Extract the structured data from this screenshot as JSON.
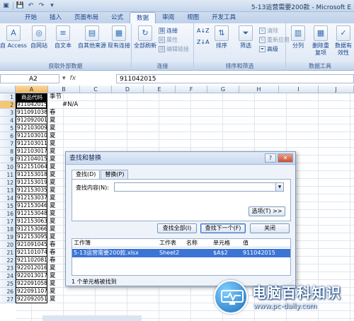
{
  "window": {
    "title": "5-13运营需要200款 - Microsoft E"
  },
  "ribbon_tabs": [
    "开始",
    "插入",
    "页面布局",
    "公式",
    "数据",
    "审阅",
    "视图",
    "开发工具"
  ],
  "active_tab_index": 4,
  "groups": {
    "external": {
      "label": "获取外部数据",
      "buttons": [
        "自 Access",
        "自网站",
        "自文本",
        "自其他来源",
        "现有连接"
      ]
    },
    "connections": {
      "label": "连接",
      "refresh": "全部刷新",
      "items": [
        "连接",
        "属性",
        "编辑链接"
      ]
    },
    "sortfilter": {
      "label": "排序和筛选",
      "sort": "排序",
      "filter": "筛选",
      "items": [
        "清除",
        "重新应用",
        "高级"
      ]
    },
    "tools": {
      "label": "数据工具",
      "buttons": [
        "分列",
        "删除重复项",
        "数据有效性"
      ]
    }
  },
  "formula_bar": {
    "name_box": "A2",
    "fx": "fx",
    "value": "911042015"
  },
  "columns": [
    "A",
    "B",
    "C",
    "D",
    "E",
    "F",
    "G",
    "H",
    "I",
    "J"
  ],
  "sheet": {
    "header_a": "商品代码",
    "header_b": "季节",
    "b2": "#N/A",
    "rows": [
      {
        "n": "1",
        "a": "商品代码",
        "b": "季节"
      },
      {
        "n": "2",
        "a": "911042015",
        "b": "#N/A"
      },
      {
        "n": "3",
        "a": "911091038",
        "b": "春"
      },
      {
        "n": "4",
        "a": "912092001",
        "b": "夏"
      },
      {
        "n": "5",
        "a": "912103009",
        "b": "夏"
      },
      {
        "n": "6",
        "a": "912103010",
        "b": "夏"
      },
      {
        "n": "7",
        "a": "912103011",
        "b": "夏"
      },
      {
        "n": "8",
        "a": "912103017",
        "b": "夏"
      },
      {
        "n": "9",
        "a": "912104015",
        "b": "夏"
      },
      {
        "n": "10",
        "a": "912151064",
        "b": "夏"
      },
      {
        "n": "11",
        "a": "912153018",
        "b": "夏"
      },
      {
        "n": "12",
        "a": "912153019",
        "b": "夏"
      },
      {
        "n": "13",
        "a": "912153035",
        "b": "夏"
      },
      {
        "n": "14",
        "a": "912153037",
        "b": "夏"
      },
      {
        "n": "15",
        "a": "912153046",
        "b": "夏"
      },
      {
        "n": "16",
        "a": "912153048",
        "b": "夏"
      },
      {
        "n": "17",
        "a": "912153063",
        "b": "夏"
      },
      {
        "n": "18",
        "a": "912153066",
        "b": "夏"
      },
      {
        "n": "19",
        "a": "912153095",
        "b": "夏"
      },
      {
        "n": "20",
        "a": "921091045",
        "b": "春"
      },
      {
        "n": "21",
        "a": "921101074",
        "b": "春"
      },
      {
        "n": "22",
        "a": "921102081",
        "b": "春"
      },
      {
        "n": "23",
        "a": "922012016",
        "b": "夏"
      },
      {
        "n": "24",
        "a": "922013017",
        "b": "夏"
      },
      {
        "n": "25",
        "a": "922091058",
        "b": "夏"
      },
      {
        "n": "26",
        "a": "922091107",
        "b": "夏"
      },
      {
        "n": "27",
        "a": "922092051",
        "b": "夏"
      }
    ]
  },
  "dialog": {
    "title": "查找和替换",
    "tabs": [
      "查找(D)",
      "替换(P)"
    ],
    "find_label": "查找内容(N):",
    "find_value": "",
    "options_btn": "选项(T) >>",
    "find_all_btn": "查找全部(I)",
    "find_next_btn": "查找下一个(F)",
    "close_btn": "关闭",
    "result_headers": [
      "工作簿",
      "工作表",
      "名称",
      "单元格",
      "值"
    ],
    "result_row": [
      "5-13运营需要200款.xlsx",
      "Sheet2",
      "",
      "$A$2",
      "911042015"
    ],
    "status": "1 个单元格被找到"
  },
  "watermark": {
    "brand": "电脑百科知识",
    "url": "www.pc-daily.com"
  }
}
